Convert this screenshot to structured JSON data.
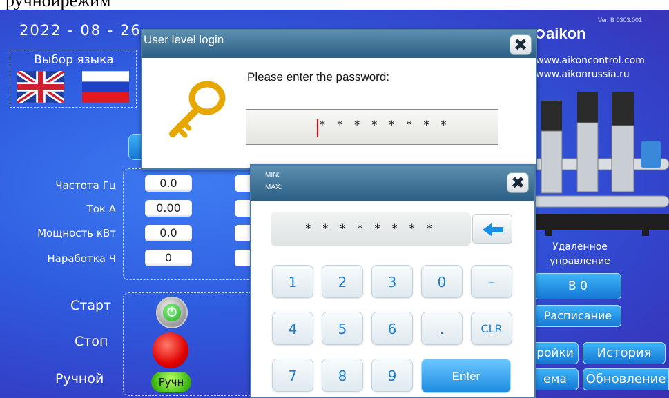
{
  "window_top_text": "ручнойрежим",
  "main": {
    "date": "2022 - 08 - 26",
    "language_title": "Выбор языка",
    "params": {
      "frequency_label": "Частота Гц",
      "frequency_value": "0.0",
      "current_label": "Ток А",
      "current_value": "0.00",
      "power_label": "Мощность кВт",
      "power_value": "0.0",
      "runtime_label": "Наработка Ч",
      "runtime_value": "0"
    },
    "controls": {
      "start_label": "Старт",
      "stop_label": "Стоп",
      "manual_label": "Ручной",
      "manual_button": "Ручн"
    }
  },
  "right_panel": {
    "version": "Ver. B 0303.001",
    "brand": "aikon",
    "site1": "www.aikoncontrol.com",
    "site2": "www.aikonrussia.ru",
    "remote_line1": "Удаленное",
    "remote_line2": "управление",
    "b0_button": "B 0",
    "schedule_button": "Расписание",
    "settings_button": "ройки",
    "history_button": "История",
    "scheme_button": "ема",
    "update_button": "Обновление"
  },
  "login_dialog": {
    "title": "User level login",
    "close_icon": "close-icon",
    "prompt": "Please enter the password:",
    "password_masked": "* * * * * * * *"
  },
  "keypad": {
    "min_label": "MIN:",
    "max_label": "MAX:",
    "display": "* * * * * * * *",
    "keys_row1": [
      "1",
      "2",
      "3",
      "0",
      "-"
    ],
    "keys_row2": [
      "4",
      "5",
      "6",
      ".",
      "CLR"
    ],
    "keys_row3": [
      "7",
      "8",
      "9"
    ],
    "enter": "Enter",
    "accent": "#1a7fd3"
  }
}
